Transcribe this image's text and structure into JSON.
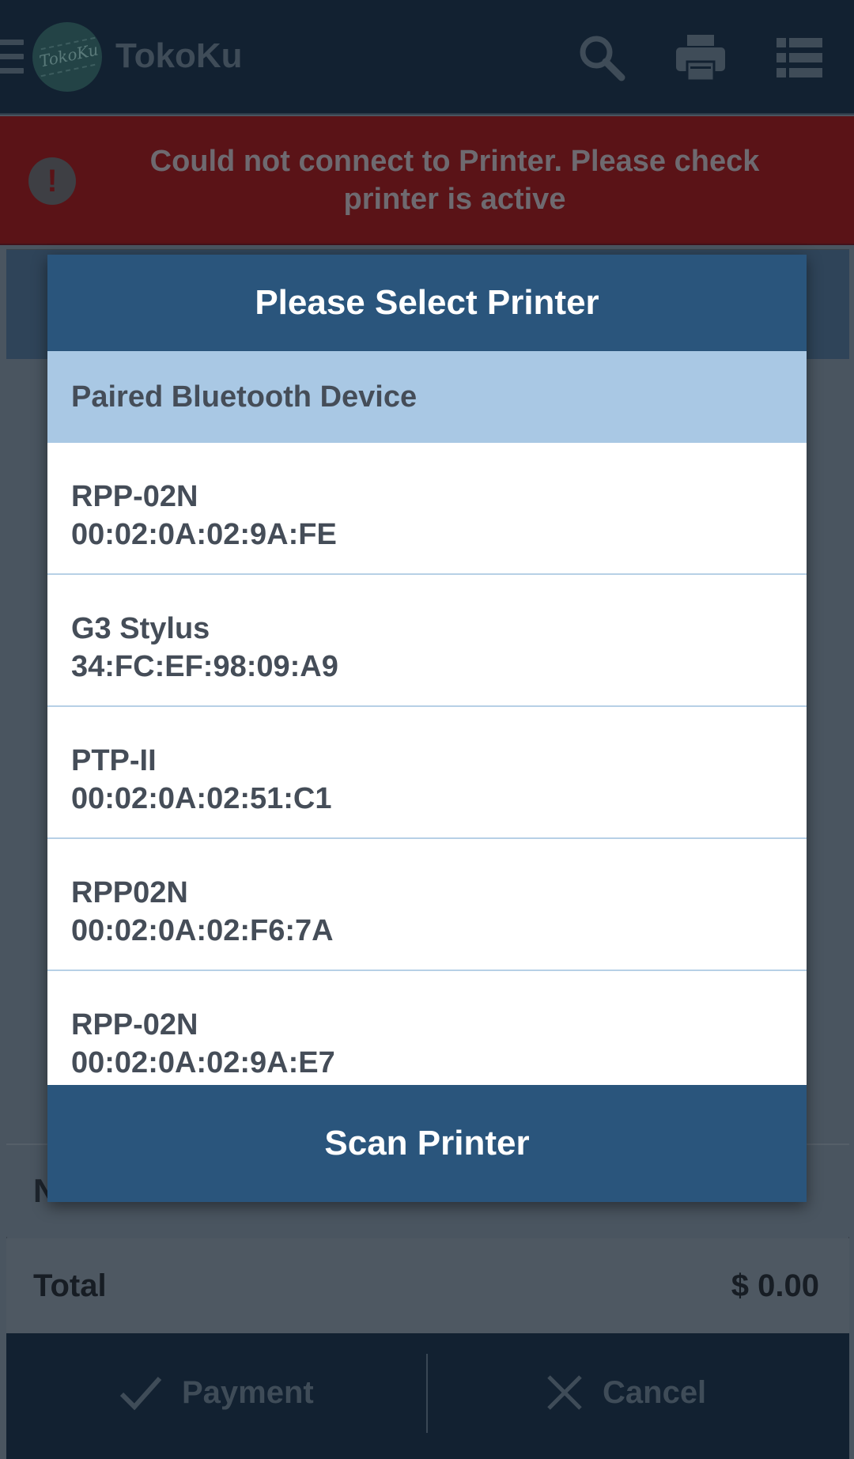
{
  "app": {
    "title": "TokoKu",
    "logo_text": "TokoKu"
  },
  "toolbar": {
    "icons": [
      "menu-icon",
      "search-icon",
      "printer-icon",
      "list-icon"
    ]
  },
  "banner": {
    "message": "Could not connect to Printer. Please check printer is active",
    "icon": "!",
    "color": "#5a1317"
  },
  "dialog": {
    "title": "Please Select Printer",
    "section_header": "Paired Bluetooth Device",
    "devices": [
      {
        "name": "RPP-02N",
        "address": "00:02:0A:02:9A:FE"
      },
      {
        "name": "G3 Stylus",
        "address": "34:FC:EF:98:09:A9"
      },
      {
        "name": "PTP-II",
        "address": "00:02:0A:02:51:C1"
      },
      {
        "name": "RPP02N",
        "address": "00:02:0A:02:F6:7A"
      },
      {
        "name": "RPP-02N",
        "address": "00:02:0A:02:9A:E7"
      }
    ],
    "scan_label": "Scan Printer",
    "accent": "#2a557c"
  },
  "underlay": {
    "partial_letter": "N",
    "total_label": "Total",
    "total_value": "$ 0.00",
    "payment_label": "Payment",
    "cancel_label": "Cancel"
  }
}
